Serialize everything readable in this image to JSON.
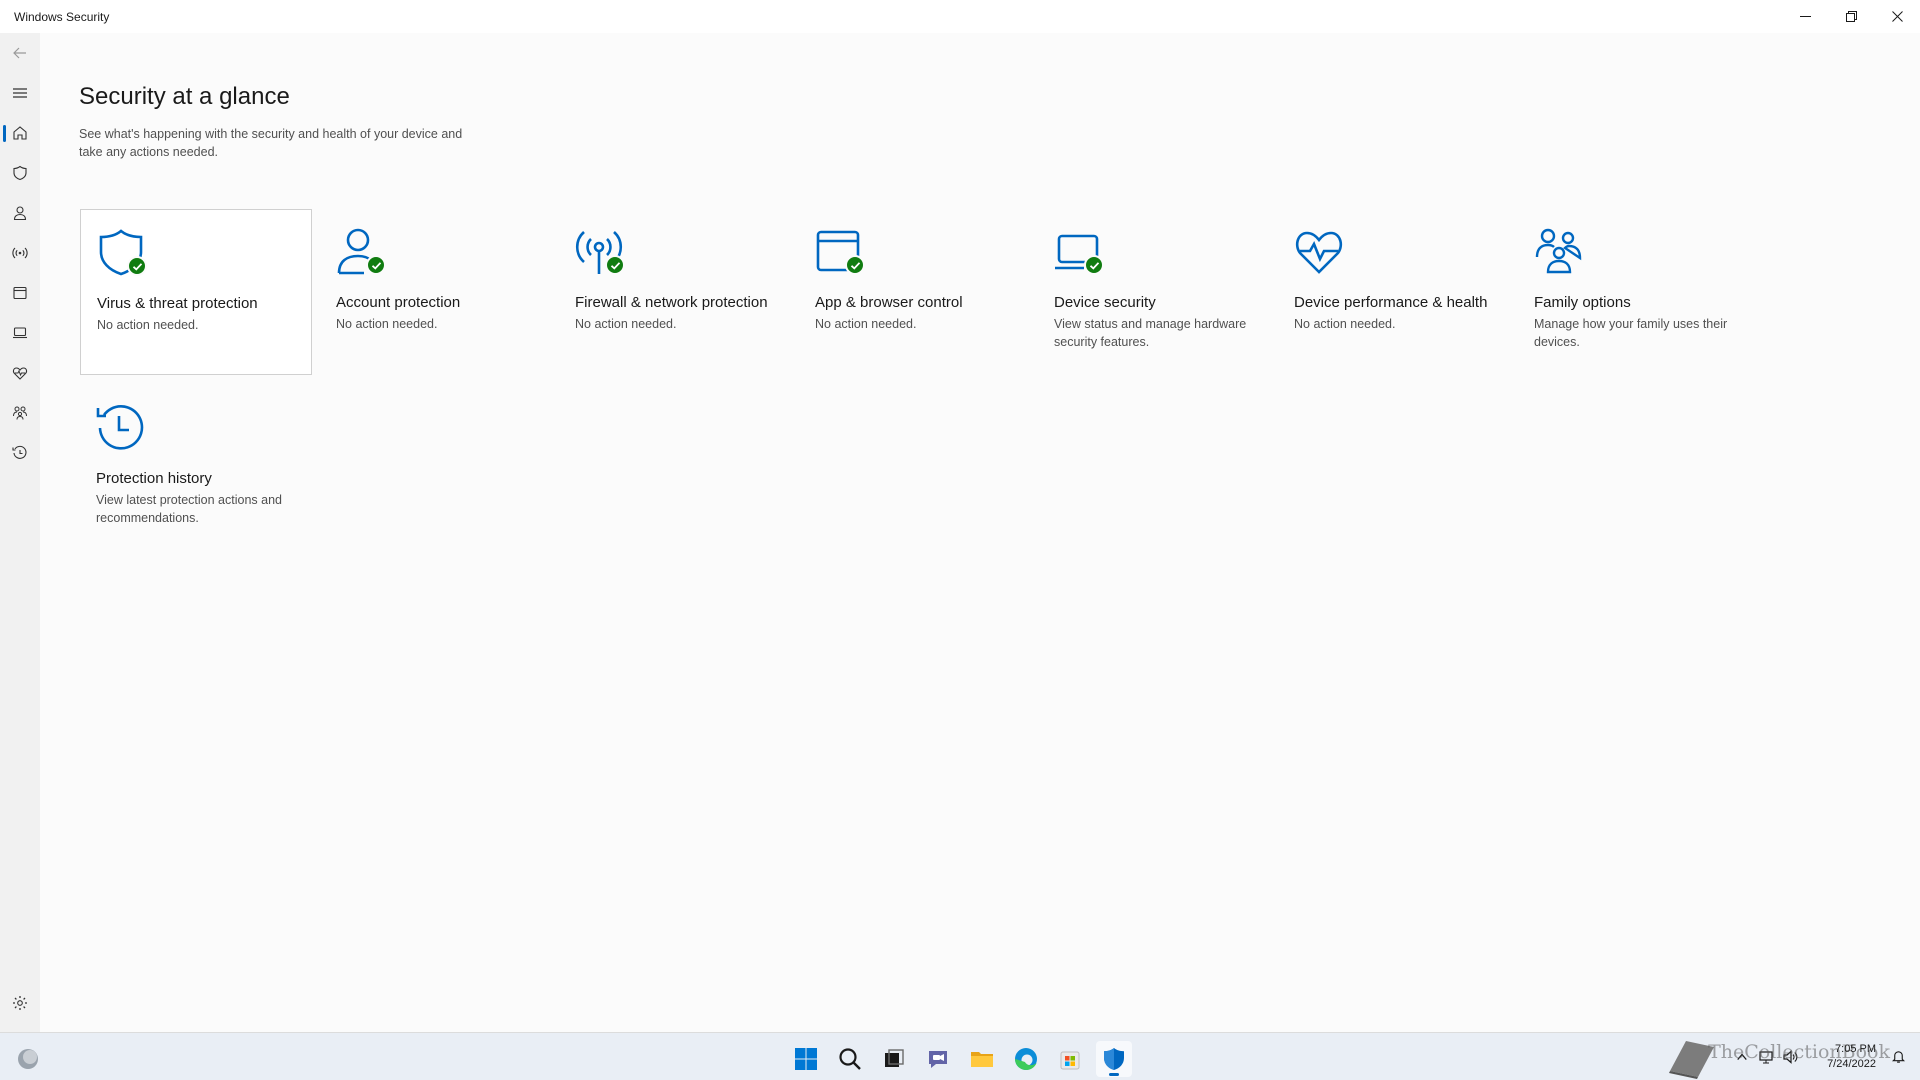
{
  "window": {
    "title": "Windows Security"
  },
  "page": {
    "title": "Security at a glance",
    "subtitle": "See what's happening with the security and health of your device and take any actions needed."
  },
  "tiles": [
    {
      "title": "Virus & threat protection",
      "status": "No action needed.",
      "icon": "shield-icon",
      "check": true
    },
    {
      "title": "Account protection",
      "status": "No action needed.",
      "icon": "person-icon",
      "check": true
    },
    {
      "title": "Firewall & network protection",
      "status": "No action needed.",
      "icon": "antenna-icon",
      "check": true
    },
    {
      "title": "App & browser control",
      "status": "No action needed.",
      "icon": "browser-window-icon",
      "check": true
    },
    {
      "title": "Device security",
      "status": "View status and manage hardware security features.",
      "icon": "laptop-icon",
      "check": true
    },
    {
      "title": "Device performance & health",
      "status": "No action needed.",
      "icon": "heart-pulse-icon",
      "check": false
    },
    {
      "title": "Family options",
      "status": "Manage how your family uses their devices.",
      "icon": "family-icon",
      "check": false
    },
    {
      "title": "Protection history",
      "status": "View latest protection actions and recommendations.",
      "icon": "history-icon",
      "check": false
    }
  ],
  "nav": [
    "back-arrow-icon",
    "hamburger-menu-icon",
    "home-icon",
    "shield-icon",
    "person-icon",
    "antenna-icon",
    "browser-window-icon",
    "laptop-icon",
    "heart-pulse-icon",
    "family-icon",
    "history-icon",
    "settings-gear-icon"
  ],
  "taskbar": {
    "time": "7:05 PM",
    "date": "7/24/2022",
    "watermark": "TheCollectionBook"
  },
  "colors": {
    "accent": "#0067c0",
    "success": "#107c10",
    "nav_bg": "#f1f1f1",
    "content_bg": "#fbfbfb"
  }
}
